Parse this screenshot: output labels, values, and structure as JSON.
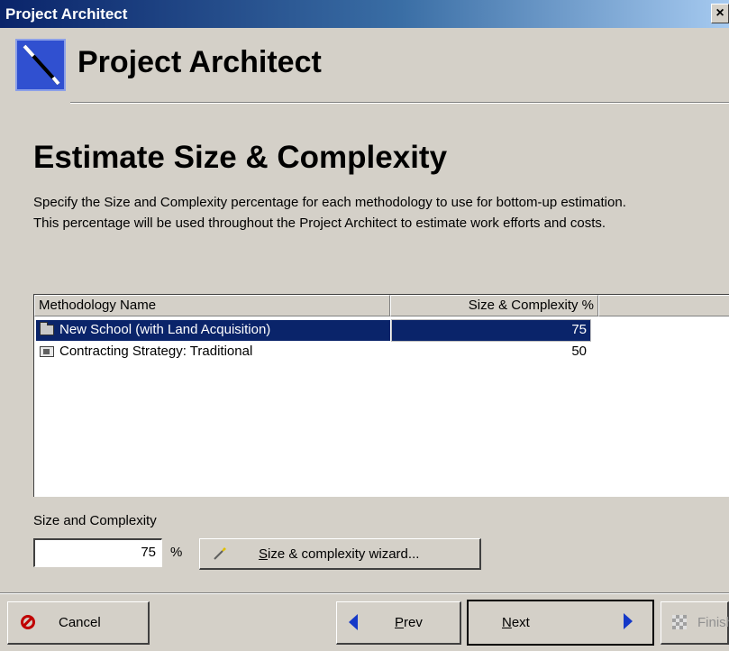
{
  "window": {
    "title": "Project Architect",
    "close_glyph": "×"
  },
  "header": {
    "title": "Project Architect",
    "icon": "magic-wand-icon"
  },
  "section": {
    "title": "Estimate Size & Complexity",
    "description_line1": "Specify the Size and Complexity percentage for each methodology to use for bottom-up estimation.",
    "description_line2": "This percentage will be used throughout the Project Architect to estimate work efforts and costs."
  },
  "table": {
    "columns": [
      "Methodology Name",
      "Size & Complexity %"
    ],
    "rows": [
      {
        "name": "New School (with Land Acquisition)",
        "percent": "75",
        "icon": "folder-icon",
        "selected": true
      },
      {
        "name": "Contracting Strategy: Traditional",
        "percent": "50",
        "icon": "strategy-icon",
        "selected": false
      }
    ]
  },
  "size_field": {
    "label": "Size and Complexity",
    "value": "75",
    "unit": "%"
  },
  "wizard_button": {
    "accel": "S",
    "rest": "ize & complexity wizard..."
  },
  "buttons": {
    "cancel": "Cancel",
    "prev_accel": "P",
    "prev_rest": "rev",
    "next_accel": "N",
    "next_rest": "ext",
    "finish": "Finish"
  },
  "colors": {
    "selection": "#0a246a",
    "face": "#d4d0c8",
    "arrow": "#1438c8"
  }
}
